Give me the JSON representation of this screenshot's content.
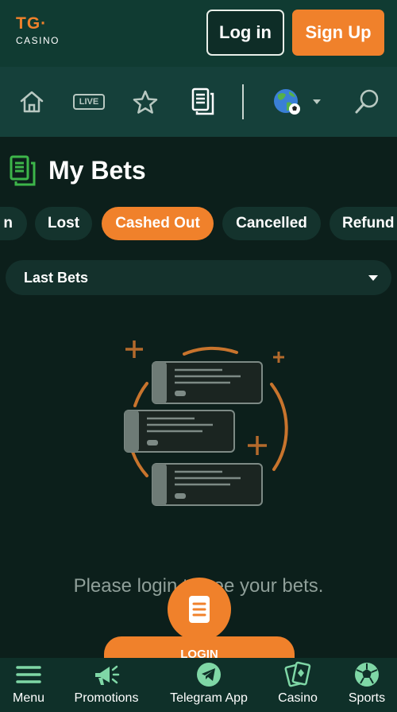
{
  "header": {
    "logo_top": "TG·",
    "logo_bottom": "CASINO",
    "login_label": "Log in",
    "signup_label": "Sign Up"
  },
  "nav": {
    "live_label": "LIVE"
  },
  "page": {
    "title": "My Bets"
  },
  "filters": {
    "items": [
      "n",
      "Lost",
      "Cashed Out",
      "Cancelled",
      "Refund"
    ],
    "active": "Cashed Out"
  },
  "select": {
    "value": "Last Bets"
  },
  "empty_state": {
    "message": "Please login to see your bets.",
    "login_label": "LOGIN"
  },
  "bottom_nav": {
    "items": [
      "Menu",
      "Promotions",
      "Telegram App",
      "Casino",
      "Sports"
    ]
  },
  "colors": {
    "accent": "#f0812b",
    "header_bg": "#103b32",
    "nav_bg": "#15403a",
    "page_bg": "#0c1f1b",
    "icon_green": "#3db54a"
  },
  "icons": [
    "home-icon",
    "live-icon",
    "star-icon",
    "bets-icon",
    "globe-icon",
    "chevron-down-icon",
    "search-icon",
    "menu-icon",
    "megaphone-icon",
    "telegram-icon",
    "cards-icon",
    "soccer-ball-icon"
  ]
}
